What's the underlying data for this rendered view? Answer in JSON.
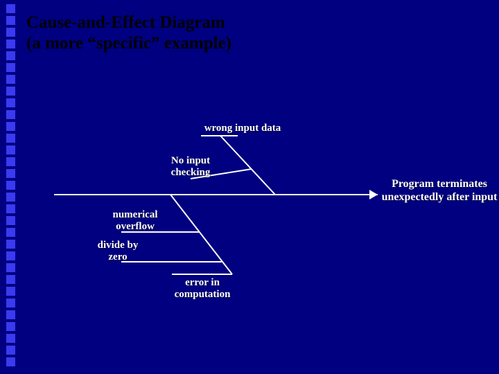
{
  "title": {
    "line1": "Cause-and-Effect  Diagram",
    "line2": "(a more “specific” example)"
  },
  "effect": {
    "line1": "Program terminates",
    "line2": "unexpectedly after input"
  },
  "causes": {
    "top_bone": "wrong input data",
    "top_sub": "No input\nchecking",
    "bottom_bone": "error in\ncomputation",
    "bottom_sub1": "numerical\noverflow",
    "bottom_sub2": "divide by\nzero"
  },
  "colors": {
    "bg": "#000080",
    "title": "#000000",
    "text": "#ffffff"
  }
}
